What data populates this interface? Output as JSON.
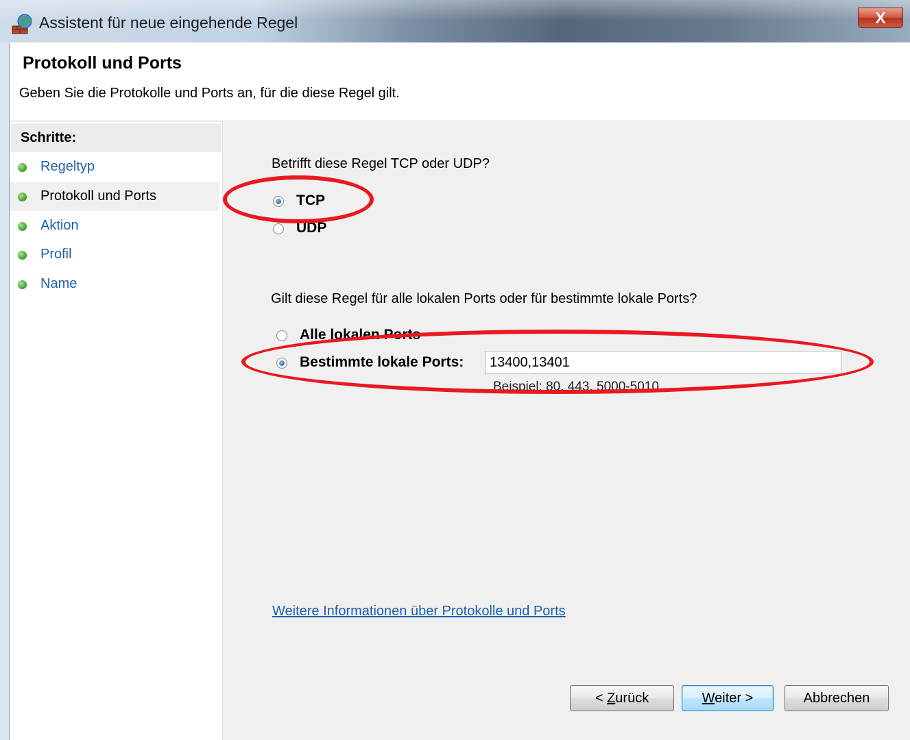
{
  "window": {
    "title": "Assistent für neue eingehende Regel",
    "close_label": "X"
  },
  "header": {
    "title": "Protokoll und Ports",
    "subtitle": "Geben Sie die Protokolle und Ports an, für die diese Regel gilt."
  },
  "steps": {
    "heading": "Schritte:",
    "items": [
      {
        "label": "Regeltyp",
        "current": false
      },
      {
        "label": "Protokoll und Ports",
        "current": true
      },
      {
        "label": "Aktion",
        "current": false
      },
      {
        "label": "Profil",
        "current": false
      },
      {
        "label": "Name",
        "current": false
      }
    ]
  },
  "protocol": {
    "question": "Betrifft diese Regel TCP oder UDP?",
    "options": [
      "TCP",
      "UDP"
    ],
    "selected": "TCP"
  },
  "ports": {
    "question": "Gilt diese Regel für alle lokalen Ports oder für bestimmte lokale Ports?",
    "options": [
      "Alle lokalen Ports",
      "Bestimmte lokale Ports:"
    ],
    "selected": "Bestimmte lokale Ports:",
    "value": "13400,13401",
    "example": "Beispiel: 80, 443, 5000-5010"
  },
  "info_link": "Weitere Informationen über Protokolle und Ports",
  "buttons": {
    "back": {
      "prefix": "< ",
      "accel": "Z",
      "rest": "urück"
    },
    "next": {
      "prefix": "",
      "accel": "W",
      "rest": "eiter >"
    },
    "cancel": "Abbrechen"
  },
  "colors": {
    "link": "#1b5fb0",
    "annotation": "#e8191f",
    "step_dot": "#3a9c2d"
  }
}
